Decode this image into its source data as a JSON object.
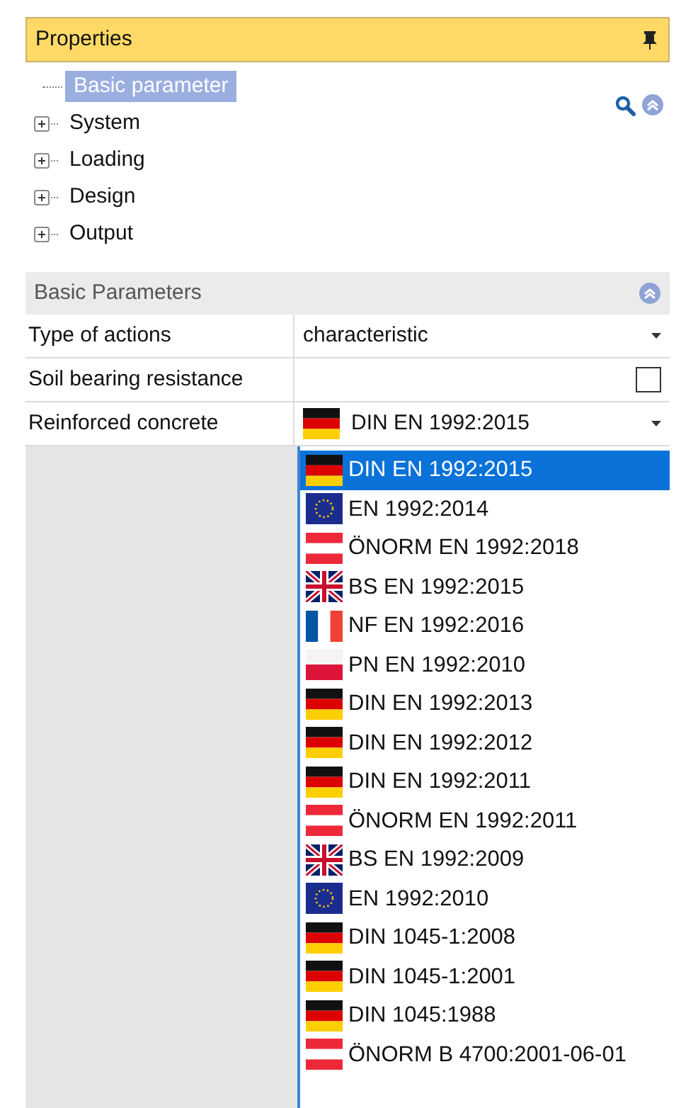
{
  "panel": {
    "title": "Properties"
  },
  "tree": [
    {
      "label": "Basic parameter",
      "kind": "leaf",
      "selected": true
    },
    {
      "label": "System",
      "kind": "folder",
      "expanded": false,
      "selected": false
    },
    {
      "label": "Loading",
      "kind": "folder",
      "expanded": false,
      "selected": false
    },
    {
      "label": "Design",
      "kind": "folder",
      "expanded": false,
      "selected": false
    },
    {
      "label": "Output",
      "kind": "folder",
      "expanded": false,
      "selected": false
    }
  ],
  "section": {
    "title": "Basic Parameters"
  },
  "rows": [
    {
      "label": "Type of actions",
      "kind": "dropdown",
      "value": "characteristic"
    },
    {
      "label": "Soil bearing resistance",
      "kind": "checkbox",
      "checked": false
    },
    {
      "label": "Reinforced concrete",
      "kind": "dropdown",
      "value": "DIN EN 1992:2015",
      "flag": {
        "kind": "de"
      }
    }
  ],
  "dropdown_list": [
    {
      "label": "DIN EN 1992:2015",
      "flag": {
        "kind": "de"
      },
      "selected": true
    },
    {
      "label": "EN 1992:2014",
      "flag": {
        "kind": "eu"
      },
      "selected": false
    },
    {
      "label": "ÖNORM EN 1992:2018",
      "flag": {
        "kind": "at"
      },
      "selected": false
    },
    {
      "label": "BS EN 1992:2015",
      "flag": {
        "kind": "gb"
      },
      "selected": false
    },
    {
      "label": "NF EN 1992:2016",
      "flag": {
        "kind": "fr"
      },
      "selected": false
    },
    {
      "label": "PN EN 1992:2010",
      "flag": {
        "kind": "pl"
      },
      "selected": false
    },
    {
      "label": "DIN EN 1992:2013",
      "flag": {
        "kind": "de"
      },
      "selected": false
    },
    {
      "label": "DIN EN 1992:2012",
      "flag": {
        "kind": "de"
      },
      "selected": false
    },
    {
      "label": "DIN EN 1992:2011",
      "flag": {
        "kind": "de"
      },
      "selected": false
    },
    {
      "label": "ÖNORM EN 1992:2011",
      "flag": {
        "kind": "at"
      },
      "selected": false
    },
    {
      "label": "BS EN 1992:2009",
      "flag": {
        "kind": "gb"
      },
      "selected": false
    },
    {
      "label": "EN 1992:2010",
      "flag": {
        "kind": "eu"
      },
      "selected": false
    },
    {
      "label": "DIN 1045-1:2008",
      "flag": {
        "kind": "de"
      },
      "selected": false
    },
    {
      "label": "DIN 1045-1:2001",
      "flag": {
        "kind": "de"
      },
      "selected": false
    },
    {
      "label": "DIN 1045:1988",
      "flag": {
        "kind": "de"
      },
      "selected": false
    },
    {
      "label": "ÖNORM B 4700:2001-06-01",
      "flag": {
        "kind": "at"
      },
      "selected": false
    }
  ]
}
